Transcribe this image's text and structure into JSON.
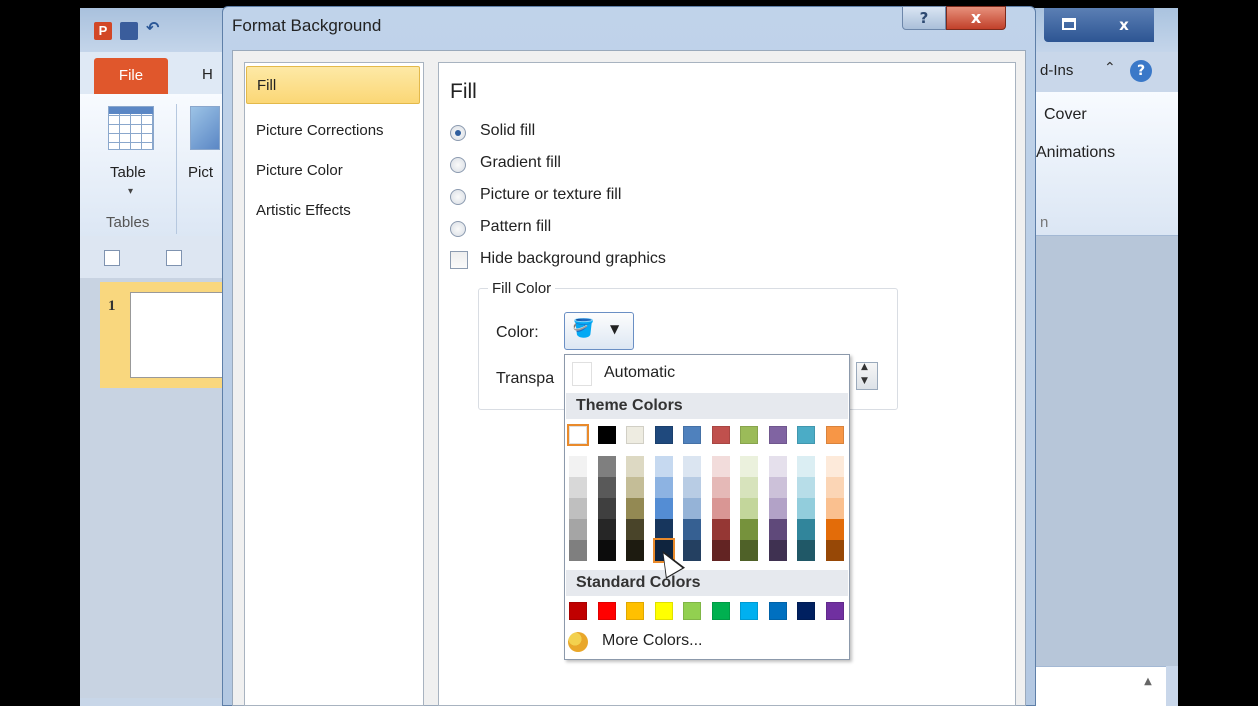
{
  "main_window": {
    "logo_letter": "P",
    "file_tab": "File",
    "home_tab_partial": "H",
    "table_label": "Table",
    "pict_label_partial": "Pict",
    "tables_group": "Tables",
    "slide_number": "1",
    "addins_tab_partial": "d-Ins",
    "help_symbol": "?",
    "cover_label": "Cover",
    "animations_label": "Animations",
    "rn_partial": "n",
    "close_symbol": "x"
  },
  "dialog": {
    "title": "Format Background",
    "help_symbol": "?",
    "close_symbol": "x",
    "nav": {
      "fill": "Fill",
      "picture_corrections": "Picture Corrections",
      "picture_color": "Picture Color",
      "artistic_effects": "Artistic Effects"
    },
    "heading": "Fill",
    "options": {
      "solid_fill": "Solid fill",
      "gradient_fill": "Gradient fill",
      "picture_texture_fill": "Picture or texture fill",
      "pattern_fill": "Pattern fill",
      "hide_background": "Hide background graphics"
    },
    "selected_fill": "solid_fill",
    "fill_color_group": "Fill Color",
    "color_label": "Color:",
    "transparency_partial": "Transpa"
  },
  "picker": {
    "automatic": "Automatic",
    "theme_colors_heading": "Theme Colors",
    "standard_colors_heading": "Standard Colors",
    "more_colors": "More Colors...",
    "theme_top": [
      "#ffffff",
      "#000000",
      "#eeece1",
      "#1f497d",
      "#4f81bd",
      "#c0504d",
      "#9bbb59",
      "#8064a2",
      "#4bacc6",
      "#f79646"
    ],
    "theme_shades": [
      [
        "#f2f2f2",
        "#d8d8d8",
        "#bfbfbf",
        "#a5a5a5",
        "#7f7f7f"
      ],
      [
        "#7f7f7f",
        "#595959",
        "#3f3f3f",
        "#262626",
        "#0c0c0c"
      ],
      [
        "#ddd9c3",
        "#c4bd97",
        "#938953",
        "#494429",
        "#1d1b10"
      ],
      [
        "#c6d9f0",
        "#8db3e2",
        "#548dd4",
        "#17365d",
        "#0f243e"
      ],
      [
        "#dbe5f1",
        "#b8cce4",
        "#95b3d7",
        "#366092",
        "#244061"
      ],
      [
        "#f2dcdb",
        "#e5b9b7",
        "#d99694",
        "#953734",
        "#632423"
      ],
      [
        "#ebf1dd",
        "#d7e3bc",
        "#c3d69b",
        "#76923c",
        "#4f6128"
      ],
      [
        "#e5e0ec",
        "#ccc1d9",
        "#b2a2c7",
        "#5f497a",
        "#3f3151"
      ],
      [
        "#dbeef3",
        "#b7dde8",
        "#92cddc",
        "#31859b",
        "#205867"
      ],
      [
        "#fdeada",
        "#fbd5b5",
        "#fac08f",
        "#e36c09",
        "#974806"
      ]
    ],
    "standard": [
      "#c00000",
      "#ff0000",
      "#ffc000",
      "#ffff00",
      "#92d050",
      "#00b050",
      "#00b0f0",
      "#0070c0",
      "#002060",
      "#7030a0"
    ],
    "selected_top_index": 0,
    "hover_shade": [
      3,
      4
    ]
  }
}
